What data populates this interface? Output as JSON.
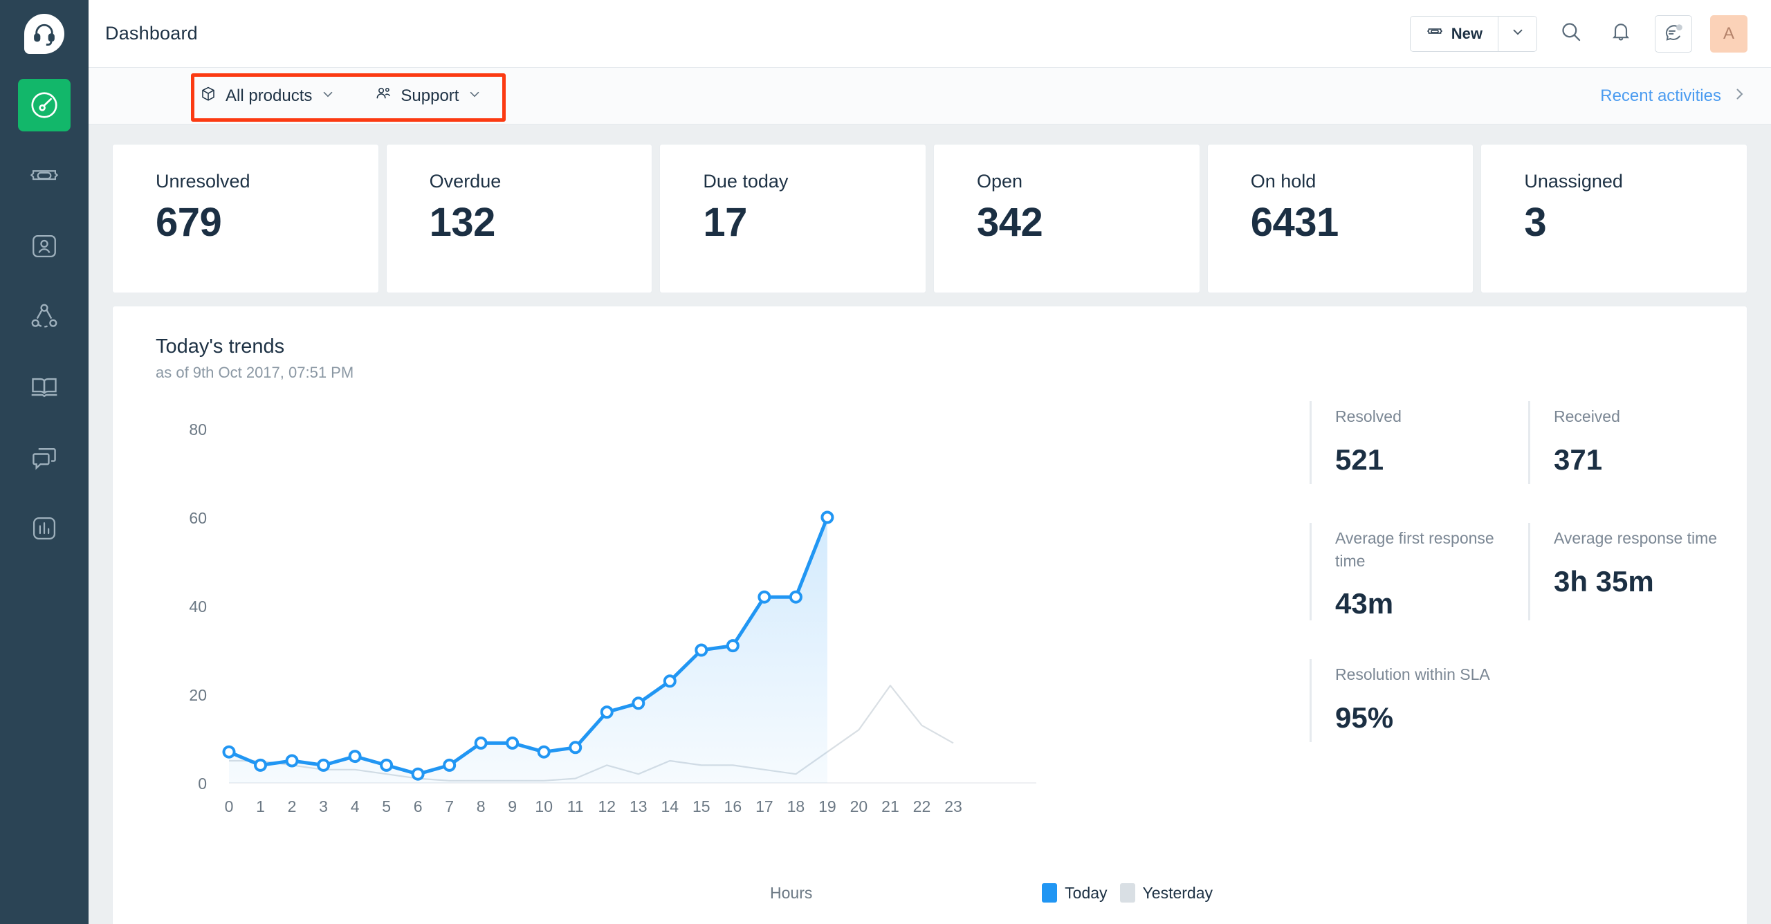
{
  "sidebar": {
    "logo": {
      "icon": "headset-logo-icon"
    },
    "items": [
      {
        "name": "dashboard",
        "icon": "speedometer-icon",
        "active": true
      },
      {
        "name": "tickets",
        "icon": "ticket-icon",
        "active": false
      },
      {
        "name": "contacts",
        "icon": "contact-card-icon",
        "active": false
      },
      {
        "name": "organizations",
        "icon": "organization-network-icon",
        "active": false
      },
      {
        "name": "solutions",
        "icon": "open-book-icon",
        "active": false
      },
      {
        "name": "forums",
        "icon": "chat-bubbles-icon",
        "active": false
      },
      {
        "name": "analytics",
        "icon": "bar-chart-icon",
        "active": false
      }
    ]
  },
  "header": {
    "title": "Dashboard",
    "new_button": {
      "label": "New",
      "icon": "ticket-icon",
      "caret": "chevron-down-icon"
    },
    "search_icon": "search-icon",
    "notifications_icon": "bell-icon",
    "chat_icon": "chat-reply-icon",
    "avatar_initial": "A"
  },
  "filter_bar": {
    "product_filter": {
      "label": "All products",
      "icon": "cube-icon",
      "caret": "chevron-down-icon"
    },
    "group_filter": {
      "label": "Support",
      "icon": "people-icon",
      "caret": "chevron-down-icon"
    },
    "recent_activities": {
      "label": "Recent activities",
      "icon": "chevron-right-icon"
    },
    "highlight_color": "#fb3a12"
  },
  "stats": [
    {
      "label": "Unresolved",
      "value": "679"
    },
    {
      "label": "Overdue",
      "value": "132"
    },
    {
      "label": "Due today",
      "value": "17"
    },
    {
      "label": "Open",
      "value": "342"
    },
    {
      "label": "On hold",
      "value": "6431"
    },
    {
      "label": "Unassigned",
      "value": "3"
    }
  ],
  "trends": {
    "title": "Today's trends",
    "subtitle": "as of 9th Oct 2017, 07:51 PM",
    "metrics": [
      {
        "label": "Resolved",
        "value": "521"
      },
      {
        "label": "Received",
        "value": "371"
      },
      {
        "label": "Average first response time",
        "value": "43m"
      },
      {
        "label": "Average response time",
        "value": "3h 35m"
      },
      {
        "label": "Resolution within SLA",
        "value": "95%"
      }
    ]
  },
  "chart_data": {
    "type": "area",
    "title": "Today's trends",
    "xlabel": "Hours",
    "ylabel": "",
    "xlim": [
      0,
      23
    ],
    "ylim": [
      0,
      80
    ],
    "yticks": [
      0,
      20,
      40,
      60,
      80
    ],
    "xticks": [
      0,
      1,
      2,
      3,
      4,
      5,
      6,
      7,
      8,
      9,
      10,
      11,
      12,
      13,
      14,
      15,
      16,
      17,
      18,
      19,
      20,
      21,
      22,
      23
    ],
    "grid": false,
    "legend_position": "bottom-right",
    "colors": {
      "today": "#2196f3",
      "yesterday": "#d9dfe4"
    },
    "series": [
      {
        "name": "Today",
        "color": "#2196f3",
        "x": [
          0,
          1,
          2,
          3,
          4,
          5,
          6,
          7,
          8,
          9,
          10,
          11,
          12,
          13,
          14,
          15,
          16,
          17,
          18,
          19
        ],
        "values": [
          7,
          4,
          5,
          4,
          6,
          4,
          2,
          4,
          9,
          9,
          7,
          8,
          16,
          18,
          23,
          30,
          31,
          42,
          42,
          60
        ]
      },
      {
        "name": "Yesterday",
        "color": "#d9dfe4",
        "x": [
          0,
          1,
          2,
          3,
          4,
          5,
          6,
          7,
          8,
          9,
          10,
          11,
          12,
          13,
          14,
          15,
          16,
          17,
          18,
          19,
          20,
          21,
          22,
          23
        ],
        "values": [
          5,
          5,
          4,
          3,
          3,
          2,
          1,
          0.5,
          0.5,
          0.5,
          0.5,
          1,
          4,
          2,
          5,
          4,
          4,
          3,
          2,
          7,
          12,
          22,
          13,
          9
        ]
      }
    ]
  }
}
